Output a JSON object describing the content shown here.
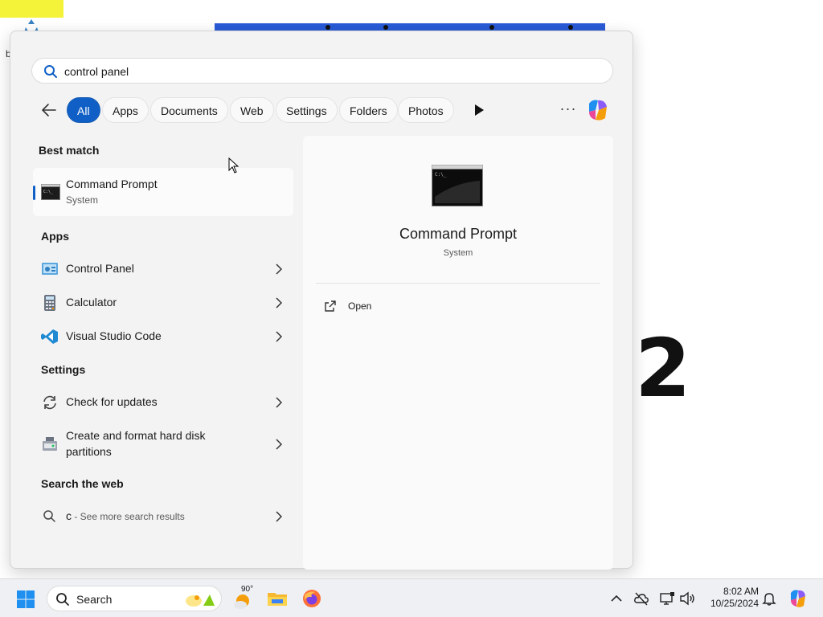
{
  "search": {
    "query": "control panel",
    "placeholder": ""
  },
  "filters": {
    "back_label": "Back",
    "chips": [
      "All",
      "Apps",
      "Documents",
      "Web",
      "Settings",
      "Folders",
      "Photos"
    ],
    "active": "All",
    "more_label": "···"
  },
  "best_match": {
    "heading": "Best match",
    "title": "Command Prompt",
    "subtitle": "System"
  },
  "apps": {
    "heading": "Apps",
    "items": [
      {
        "label": "Control Panel",
        "icon": "control-panel-icon"
      },
      {
        "label": "Calculator",
        "icon": "calculator-icon"
      },
      {
        "label": "Visual Studio Code",
        "icon": "vscode-icon"
      }
    ]
  },
  "settings": {
    "heading": "Settings",
    "items": [
      {
        "label": "Check for updates",
        "icon": "refresh-icon"
      },
      {
        "label": "Create and format hard disk partitions",
        "icon": "disk-management-icon"
      }
    ]
  },
  "web": {
    "heading": "Search the web",
    "query": "c",
    "more": " - See more search results"
  },
  "preview": {
    "title": "Command Prompt",
    "subtitle": "System",
    "actions": [
      {
        "label": "Open",
        "icon": "open-external-icon"
      }
    ]
  },
  "desktop": {
    "big_text": "2"
  },
  "taskbar": {
    "search_label": "Search",
    "weather_temp": "90°",
    "time": "8:02 AM",
    "date": "10/25/2024",
    "colors": {
      "accent": "#0f5fc6",
      "taskbar_bg": "#eef0f4"
    }
  }
}
